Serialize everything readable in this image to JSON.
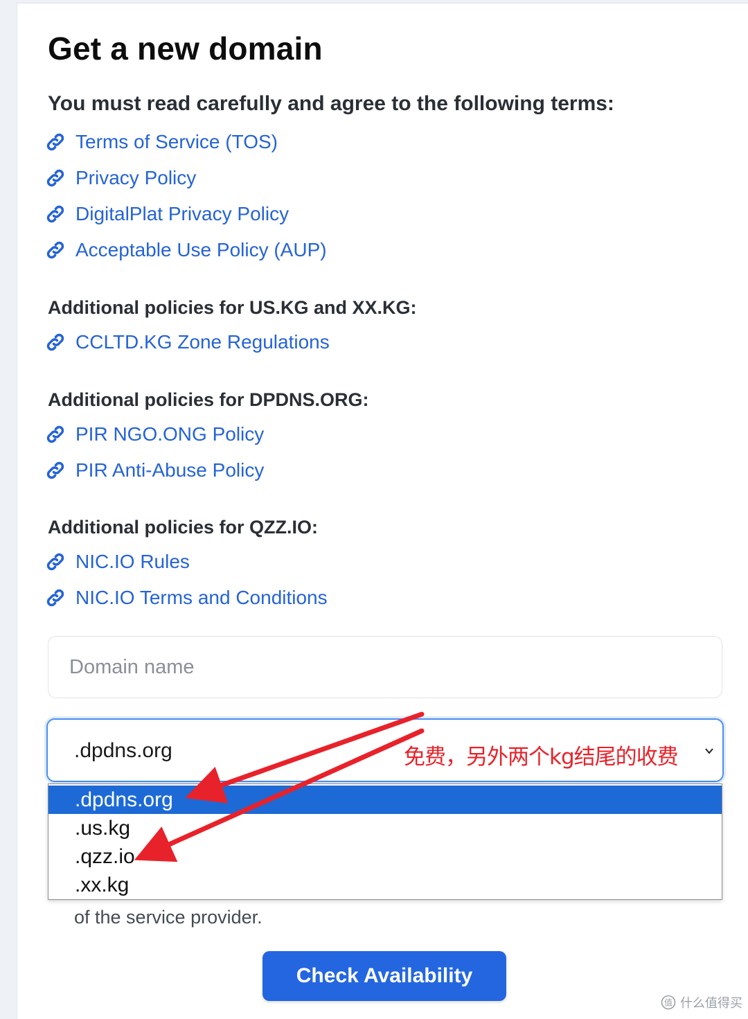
{
  "page": {
    "title": "Get a new domain",
    "terms_heading": "You must read carefully and agree to the following terms:"
  },
  "links_main": [
    {
      "label": "Terms of Service (TOS)"
    },
    {
      "label": "Privacy Policy"
    },
    {
      "label": "DigitalPlat Privacy Policy"
    },
    {
      "label": "Acceptable Use Policy (AUP)"
    }
  ],
  "section_kg": {
    "heading": "Additional policies for US.KG and XX.KG:",
    "links": [
      {
        "label": "CCLTD.KG Zone Regulations"
      }
    ]
  },
  "section_dpdns": {
    "heading": "Additional policies for DPDNS.ORG:",
    "links": [
      {
        "label": "PIR NGO.ONG Policy"
      },
      {
        "label": "PIR Anti-Abuse Policy"
      }
    ]
  },
  "section_qzz": {
    "heading": "Additional policies for QZZ.IO:",
    "links": [
      {
        "label": "NIC.IO Rules"
      },
      {
        "label": "NIC.IO Terms and Conditions"
      }
    ]
  },
  "form": {
    "domain_placeholder": "Domain name",
    "tld_selected": ".dpdns.org",
    "tld_options": [
      ".dpdns.org",
      ".us.kg",
      ".qzz.io",
      ".xx.kg"
    ],
    "service_text": "of the service provider.",
    "check_button_label": "Check Availability"
  },
  "annotation": {
    "text": "免费，另外两个kg结尾的收费",
    "color": "#e8222a"
  },
  "watermark": {
    "text": "值 什么值得买"
  },
  "colors": {
    "link": "#2563d6",
    "button": "#2366e0",
    "selected_option": "#1d6ad6",
    "focus_border": "#4a8ef0"
  },
  "icons": {
    "link": "link-icon",
    "dropdown": "chevron-down-icon"
  }
}
